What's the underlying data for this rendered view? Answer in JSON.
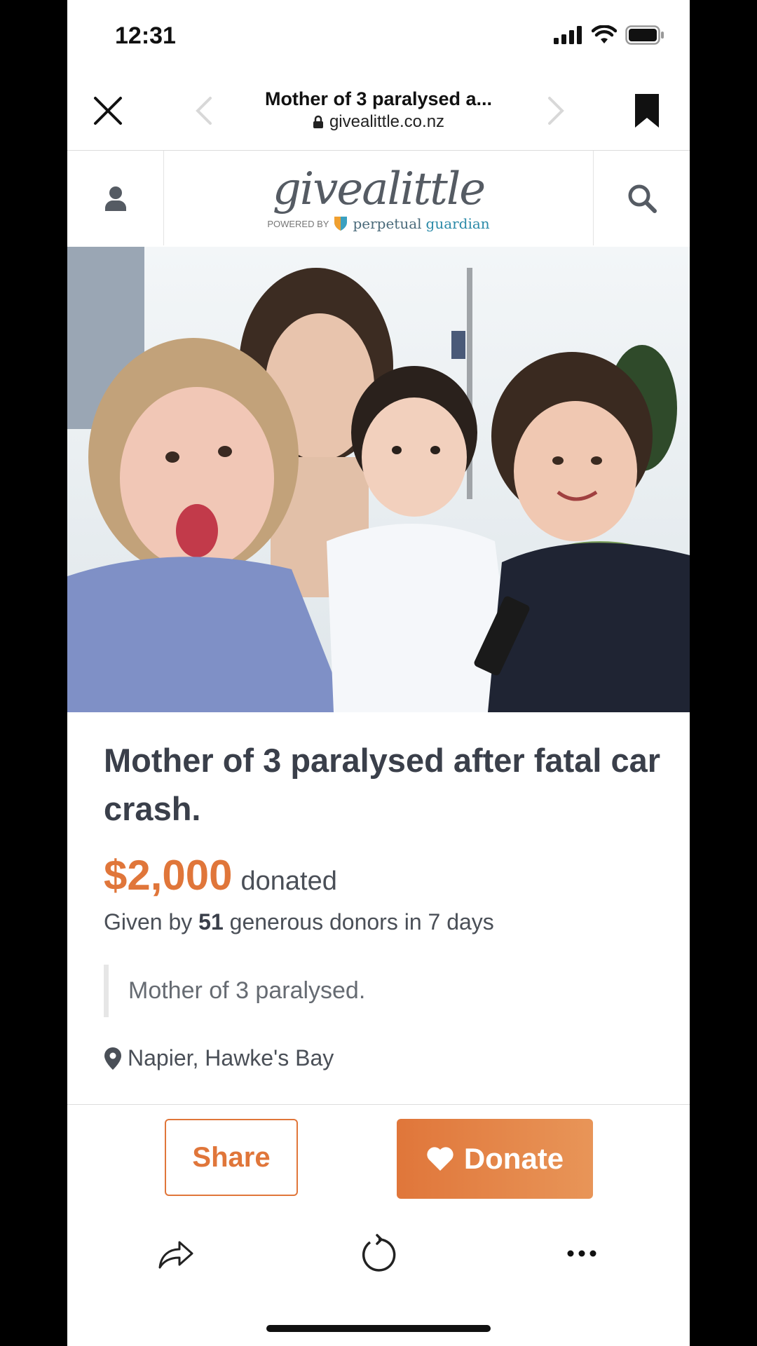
{
  "status_bar": {
    "time": "12:31"
  },
  "browser": {
    "page_title": "Mother of 3 paralysed a...",
    "url": "givealittle.co.nz"
  },
  "site": {
    "logo_text": "givealittle",
    "powered_by": "POWERED BY",
    "partner_1": "perpetual",
    "partner_2": "guardian"
  },
  "campaign": {
    "headline": "Mother of 3 paralysed after fatal car crash.",
    "amount": "$2,000",
    "amount_suffix": "donated",
    "donors_prefix": "Given by",
    "donor_count": "51",
    "donors_suffix": "generous donors in 7 days",
    "summary": "Mother of 3 paralysed.",
    "location": "Napier, Hawke's Bay"
  },
  "actions": {
    "share_label": "Share",
    "donate_label": "Donate"
  },
  "colors": {
    "accent": "#e0763a",
    "text_dark": "#3a3f4a"
  }
}
